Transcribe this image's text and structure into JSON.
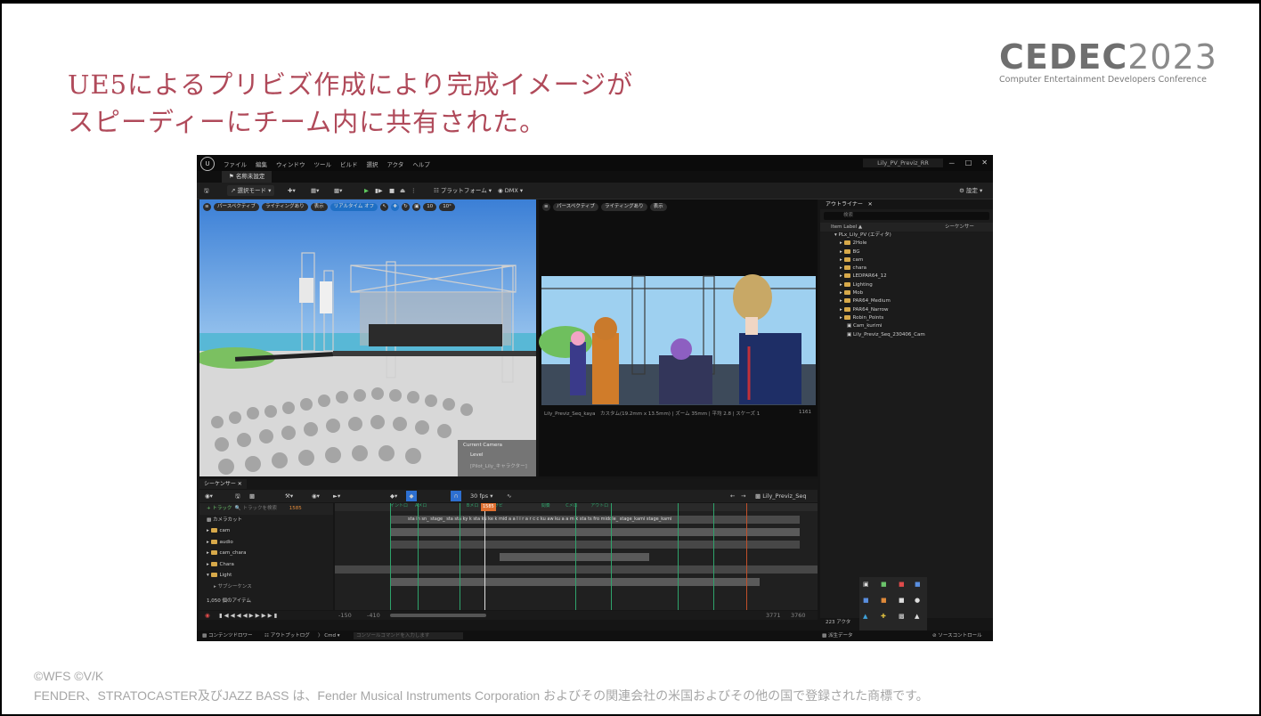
{
  "headline": {
    "line1": "UE5によるプリビズ作成により完成イメージが",
    "line2": "スピーディーにチーム内に共有された。"
  },
  "logo": {
    "brand": "CEDEC",
    "year": "2023",
    "subtitle": "Computer Entertainment Developers Conference"
  },
  "footer": {
    "copyright": "©WFS ©V/K",
    "trademark": "FENDER、STRATOCASTER及びJAZZ BASS は、Fender Musical Instruments Corporation およびその関連会社の米国およびその他の国で登録された商標です。"
  },
  "editor": {
    "menu": [
      "ファイル",
      "編集",
      "ウィンドウ",
      "ツール",
      "ビルド",
      "選択",
      "アクタ",
      "ヘルプ"
    ],
    "project_name": "Lily_PV_Previz_RR",
    "window_controls": [
      "－",
      "□",
      "✕"
    ],
    "doc_tab": "名称未設定",
    "toolbar": {
      "select_mode": "選択モード",
      "platform": "プラットフォーム",
      "dmx": "DMX",
      "settings": "設定"
    },
    "viewport1": {
      "perspective": "パースペクティブ",
      "lighting": "ライティングあり",
      "show": "表示",
      "realtime": "リアルタイム オフ",
      "grid": "10",
      "angle": "10°",
      "current_camera_label": "Current Camera",
      "pilot_label": "Level",
      "pilot_target": "[Pilot_Lily_キャラクター]"
    },
    "viewport2": {
      "perspective": "パースペクティブ",
      "lighting": "ライティングあり",
      "show": "表示",
      "caption": "Lily_Previz_Seq_kaya　カスタム(19.2mm x 13.5mm) | ズーム 35mm | 平均 2.8 | スケーズ 1",
      "frame": "1161"
    },
    "outliner": {
      "tab": "アウトライナー",
      "search_placeholder": "検索",
      "col_label": "Item Label ▲",
      "col_type": "シーケンサー",
      "items": [
        {
          "label": "PLx_Lily_PV (エディタ)",
          "folder": false
        },
        {
          "label": "2Hole",
          "folder": true
        },
        {
          "label": "BG",
          "folder": true
        },
        {
          "label": "cam",
          "folder": true
        },
        {
          "label": "chara",
          "folder": true
        },
        {
          "label": "LEDPAR64_12",
          "folder": true
        },
        {
          "label": "Lighting",
          "folder": true
        },
        {
          "label": "Mob",
          "folder": true
        },
        {
          "label": "PAR64_Medium",
          "folder": true
        },
        {
          "label": "PAR64_Narrow",
          "folder": true
        },
        {
          "label": "Robin_Points",
          "folder": true
        },
        {
          "label": "Cam_kurimi",
          "folder": false
        },
        {
          "label": "Lily_Previz_Seq_230406_Cam",
          "folder": false
        }
      ],
      "actor_count": "223 アクタ"
    },
    "sequencer": {
      "tab": "シーケンサー",
      "fps": "30 fps",
      "seq_name": "Lily_Previz_Seq",
      "add_track": "+ トラック",
      "track_search": "トラックを検索",
      "frame": "1585",
      "playhead_frame": "1585",
      "tracks": [
        "カメラカット",
        "cam",
        "audio",
        "cam_chara",
        "Chara",
        "Light",
        "サブシーケンス"
      ],
      "item_count": "1,050 個のアイテム",
      "markers": [
        "イントロ",
        "Aメロ",
        "Bメロ",
        "サビ",
        "間奏",
        "Cメロ",
        "アウトロ"
      ],
      "shot_strip": "sta  in  sn_  stage_  sta  sta  ky  k  sta  ku  ke  k  mid  a  a  l  i  r  a  r  c  c  ku  aw  ku  a  a  m  k  sta  ts  fro  middle_  stage_kami  stage_kami",
      "range_left": "-150",
      "range_left2": "-410",
      "range_right": "3771",
      "range_right2": "3760"
    },
    "statusbar": {
      "content_drawer": "コンテンツドロワー",
      "output_log": "アウトプットログ",
      "cmd": "Cmd",
      "cmd_placeholder": "コンソールコマンドを入力します",
      "derived_data": "派生データ",
      "source_control": "ソースコントロール"
    }
  }
}
